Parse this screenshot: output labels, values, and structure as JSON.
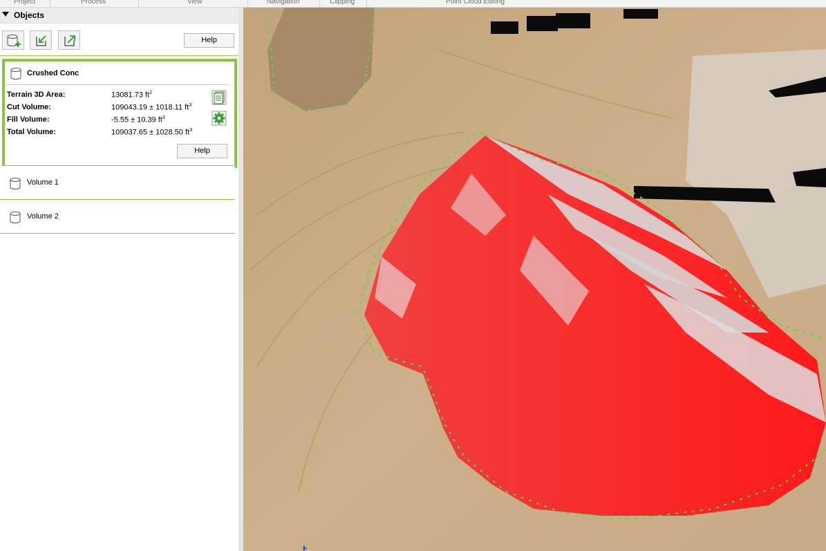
{
  "ribbon": {
    "items": [
      "Project",
      "Process",
      "View",
      "Navigation",
      "Clipping",
      "Point Cloud Editing"
    ]
  },
  "panel": {
    "title": "Objects",
    "toolbar": {
      "help_label": "Help",
      "icons": [
        "new-volume-icon",
        "import-icon",
        "export-icon"
      ]
    },
    "selected_volume": {
      "name": "Crushed Conc",
      "metrics": [
        {
          "label": "Terrain 3D Area:",
          "value": "13081.73  ft",
          "unit_exp": "2"
        },
        {
          "label": "Cut Volume:",
          "value": "109043.19  ± 1018.11  ft",
          "unit_exp": "3"
        },
        {
          "label": "Fill Volume:",
          "value": "-5.55  ± 10.39  ft",
          "unit_exp": "3"
        },
        {
          "label": "Total Volume:",
          "value": "109037.65  ± 1028.50  ft",
          "unit_exp": "3"
        }
      ],
      "help_label": "Help",
      "icons": [
        "report-icon",
        "settings-gear-icon"
      ]
    },
    "volumes": [
      {
        "name": "Volume 1"
      },
      {
        "name": "Volume 2"
      }
    ]
  },
  "viewport": {
    "content": "3d-point-cloud-stockpile",
    "colors": {
      "ground": "#c9ab84",
      "stockpile_cut": "#ff2020",
      "stockpile_gray": "#d8d8d8",
      "boundary": "#33ee33"
    }
  }
}
